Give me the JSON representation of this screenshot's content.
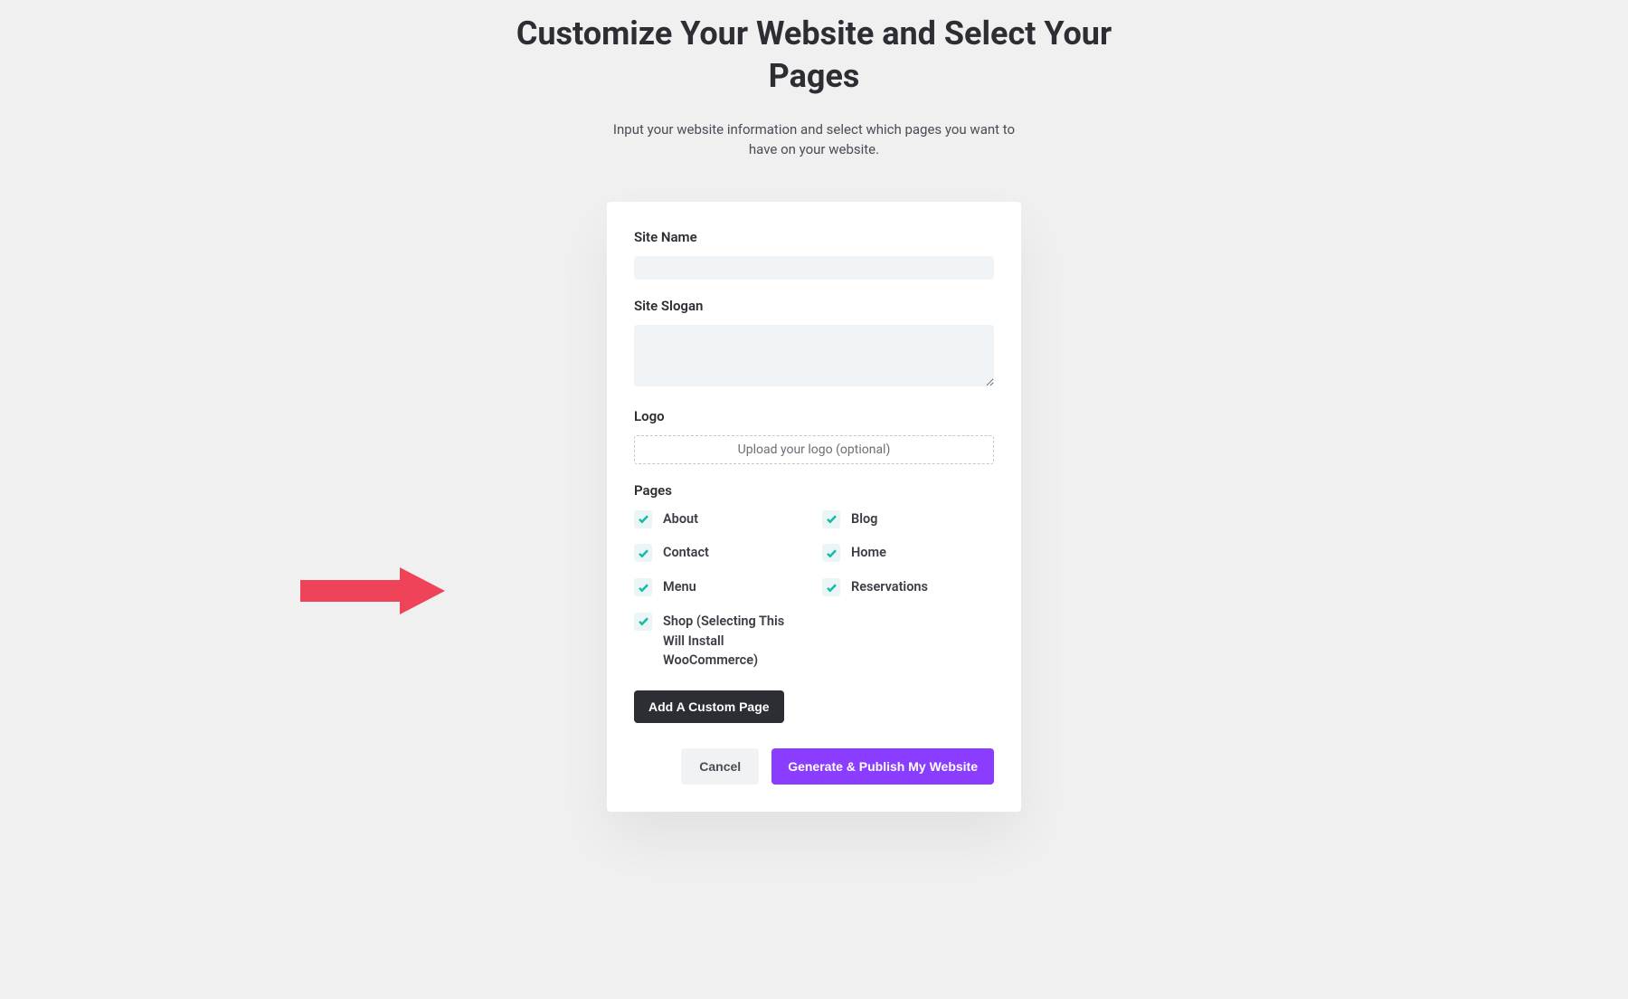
{
  "header": {
    "title": "Customize Your Website and Select Your Pages",
    "subtitle": "Input your website information and select which pages you want to have on your website."
  },
  "form": {
    "site_name_label": "Site Name",
    "site_name_value": "",
    "site_slogan_label": "Site Slogan",
    "site_slogan_value": "",
    "logo_label": "Logo",
    "logo_upload_text": "Upload your logo (optional)",
    "pages_label": "Pages",
    "pages": [
      {
        "label": "About",
        "checked": true
      },
      {
        "label": "Blog",
        "checked": true
      },
      {
        "label": "Contact",
        "checked": true
      },
      {
        "label": "Home",
        "checked": true
      },
      {
        "label": "Menu",
        "checked": true
      },
      {
        "label": "Reservations",
        "checked": true
      },
      {
        "label": "Shop (Selecting This Will Install WooCommerce)",
        "checked": true
      }
    ],
    "add_custom_page_label": "Add A Custom Page"
  },
  "actions": {
    "cancel_label": "Cancel",
    "publish_label": "Generate & Publish My Website"
  },
  "colors": {
    "accent": "#8b3dff",
    "check": "#17b8a6",
    "annotation_arrow": "#ef4359"
  }
}
